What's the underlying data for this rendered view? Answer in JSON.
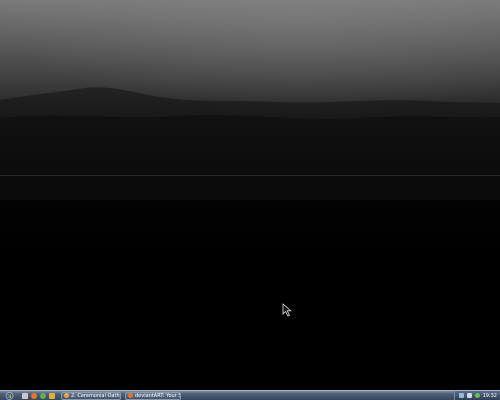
{
  "desktop": {
    "wallpaper": "dark misty landscape"
  },
  "taskbar": {
    "start_icon": "start-orb-icon",
    "quick_launch": [
      {
        "icon": "show-desktop-icon",
        "color": "#c9c9c9"
      },
      {
        "icon": "firefox-icon",
        "color": "#e7742a"
      },
      {
        "icon": "media-player-icon",
        "color": "#5fb54b"
      },
      {
        "icon": "folder-icon",
        "color": "#d8b23a"
      }
    ],
    "tasks": [
      {
        "label": "2. Ceremonial Oath - ...",
        "icon": "media-player-icon",
        "icon_color": "#e4a84a"
      },
      {
        "label": "deviantART: Your Se...",
        "icon": "firefox-icon",
        "icon_color": "#e7742a"
      }
    ],
    "tray_icons": [
      {
        "icon": "network-icon",
        "color": "#9fb7d6"
      },
      {
        "icon": "volume-icon",
        "color": "#cfd8e4"
      },
      {
        "icon": "security-icon",
        "color": "#6dbb57"
      }
    ],
    "clock": "19:32"
  }
}
